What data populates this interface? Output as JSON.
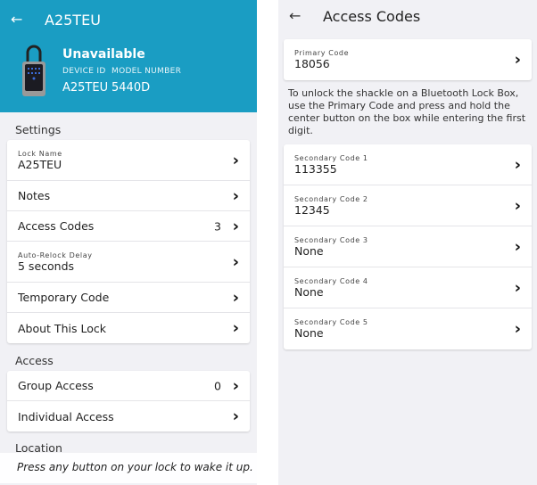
{
  "lock": {
    "title": "A25TEU",
    "status": "Unavailable",
    "device_id_label": "DEVICE ID",
    "model_label": "MODEL NUMBER",
    "device_id": "A25TEU",
    "model": "5440D",
    "accent": "#1a9dc3"
  },
  "settings": {
    "heading": "Settings",
    "lock_name_label": "Lock Name",
    "lock_name": "A25TEU",
    "notes": "Notes",
    "access_codes": "Access Codes",
    "access_codes_count": "3",
    "relock_label": "Auto-Relock Delay",
    "relock": "5 seconds",
    "temp_code": "Temporary Code",
    "about": "About This Lock"
  },
  "access": {
    "heading": "Access",
    "group": "Group Access",
    "group_count": "0",
    "individual": "Individual Access"
  },
  "location": {
    "heading": "Location"
  },
  "toast": "Press any button on your lock to wake it up.",
  "codes": {
    "title": "Access Codes",
    "primary_label": "Primary Code",
    "primary": "18056",
    "note": "To unlock the shackle on a Bluetooth Lock Box, use the Primary Code and press and hold the center button on the box while entering the first digit.",
    "secondary": [
      {
        "label": "Secondary Code 1",
        "value": "113355"
      },
      {
        "label": "Secondary Code 2",
        "value": "12345"
      },
      {
        "label": "Secondary Code 3",
        "value": "None"
      },
      {
        "label": "Secondary Code 4",
        "value": "None"
      },
      {
        "label": "Secondary Code 5",
        "value": "None"
      }
    ]
  }
}
